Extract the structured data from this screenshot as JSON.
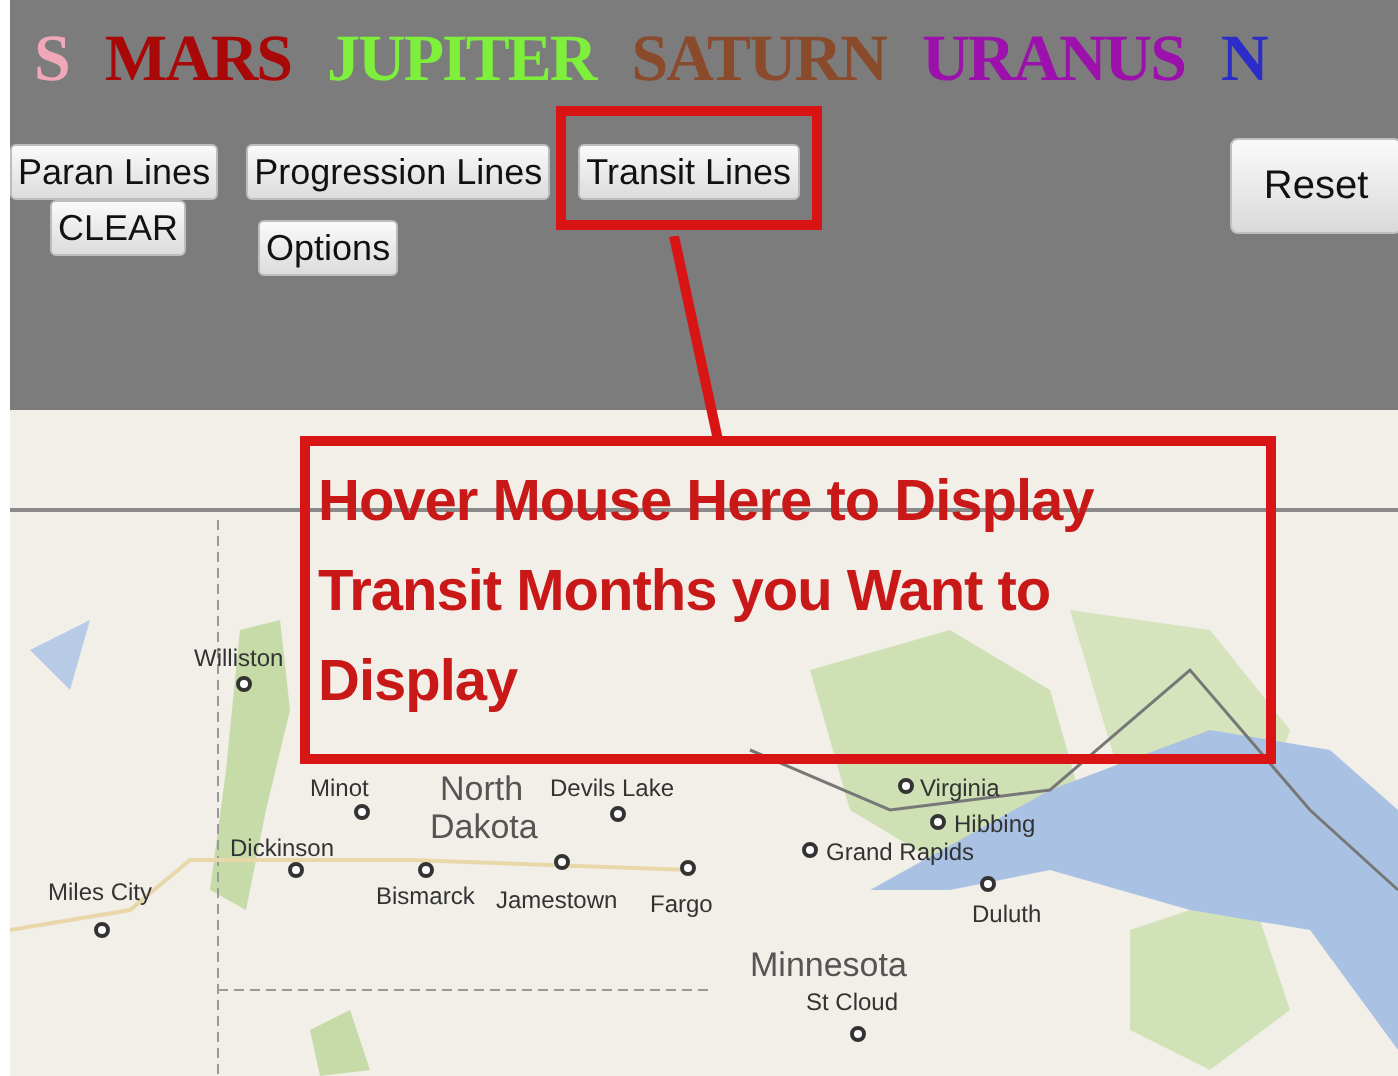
{
  "planets": [
    {
      "label": "S",
      "color": "#f0a8b8"
    },
    {
      "label": "MARS",
      "color": "#a80808"
    },
    {
      "label": "JUPITER",
      "color": "#7ef03c"
    },
    {
      "label": "SATURN",
      "color": "#8a4a2c"
    },
    {
      "label": "URANUS",
      "color": "#9c10ac"
    },
    {
      "label": "N",
      "color": "#2c2cc8"
    }
  ],
  "buttons": [
    {
      "label": "Paran Lines",
      "highlighted": false
    },
    {
      "label": "Progression Lines",
      "highlighted": false
    },
    {
      "label": "Transit Lines",
      "highlighted": true
    }
  ],
  "buttons_row_2": [
    {
      "label": "CLEAR"
    },
    {
      "label": "Options"
    }
  ],
  "reset_button": "Reset",
  "callout": "Hover Mouse Here to Display Transit Months you Want to Display",
  "map": {
    "labels": [
      {
        "text": "Williston",
        "kind": "city"
      },
      {
        "text": "Minot",
        "kind": "city"
      },
      {
        "text": "North",
        "kind": "region"
      },
      {
        "text": "Devils Lake",
        "kind": "city"
      },
      {
        "text": "Virginia",
        "kind": "city"
      },
      {
        "text": "Dakota",
        "kind": "region"
      },
      {
        "text": "Hibbing",
        "kind": "city"
      },
      {
        "text": "Dickinson",
        "kind": "city"
      },
      {
        "text": "Grand Rapids",
        "kind": "city"
      },
      {
        "text": "Miles City",
        "kind": "city"
      },
      {
        "text": "Bismarck",
        "kind": "city"
      },
      {
        "text": "Jamestown",
        "kind": "city"
      },
      {
        "text": "Fargo",
        "kind": "city"
      },
      {
        "text": "Duluth",
        "kind": "city"
      },
      {
        "text": "Minnesota",
        "kind": "region"
      },
      {
        "text": "St Cloud",
        "kind": "city"
      }
    ]
  }
}
